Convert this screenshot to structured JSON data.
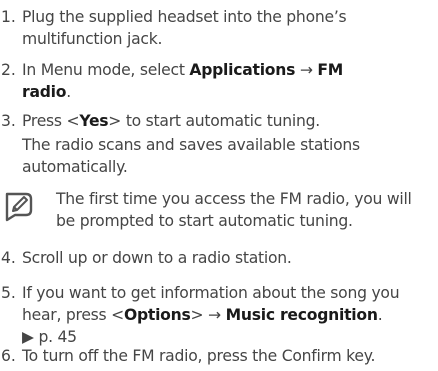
{
  "steps": [
    {
      "num": "1.",
      "line1": "Plug the supplied headset into the phone’s",
      "line2": "multifunction jack."
    },
    {
      "num": "2.",
      "pre": "In Menu mode, select ",
      "b1": "Applications",
      "arrow": " → ",
      "b2": "FM",
      "b3": "radio",
      "post": "."
    },
    {
      "num": "3.",
      "pre": "Press <",
      "b1": "Yes",
      "post": "> to start automatic tuning.",
      "line2": "The radio scans and saves available stations",
      "line3": "automatically."
    },
    {
      "num": "4.",
      "line1": "Scroll up or down to a radio station."
    },
    {
      "num": "5.",
      "line1": "If you want to get information about the song you",
      "pre": "hear, press <",
      "b1": "Options",
      "mid": "> → ",
      "b2": "Music recognition",
      "post": ".",
      "ref": "▶ p. 45"
    },
    {
      "num": "6.",
      "line1": "To turn off the FM radio, press the Confirm key."
    }
  ],
  "note": {
    "line1": "The first time you access the FM radio, you will",
    "line2": "be prompted to start automatic tuning.",
    "icon": "note-pencil-icon"
  }
}
